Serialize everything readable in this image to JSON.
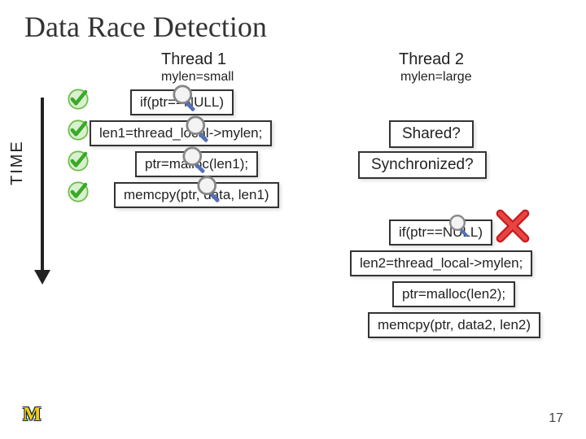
{
  "title": "Data Race Detection",
  "thread1": {
    "header": "Thread 1",
    "sub": "mylen=small",
    "lines": [
      "if(ptr==NULL)",
      "len1=thread_local->mylen;",
      "ptr=malloc(len1);",
      "memcpy(ptr, data, len1)"
    ]
  },
  "thread2": {
    "header": "Thread 2",
    "sub": "mylen=large",
    "lines": [
      "if(ptr==NULL)",
      "len2=thread_local->mylen;",
      "ptr=malloc(len2);",
      "memcpy(ptr, data2, len2)"
    ]
  },
  "labels": {
    "shared": "Shared?",
    "synchronized": "Synchronized?"
  },
  "axis_label": "TIME",
  "page": "17",
  "logo": "M"
}
